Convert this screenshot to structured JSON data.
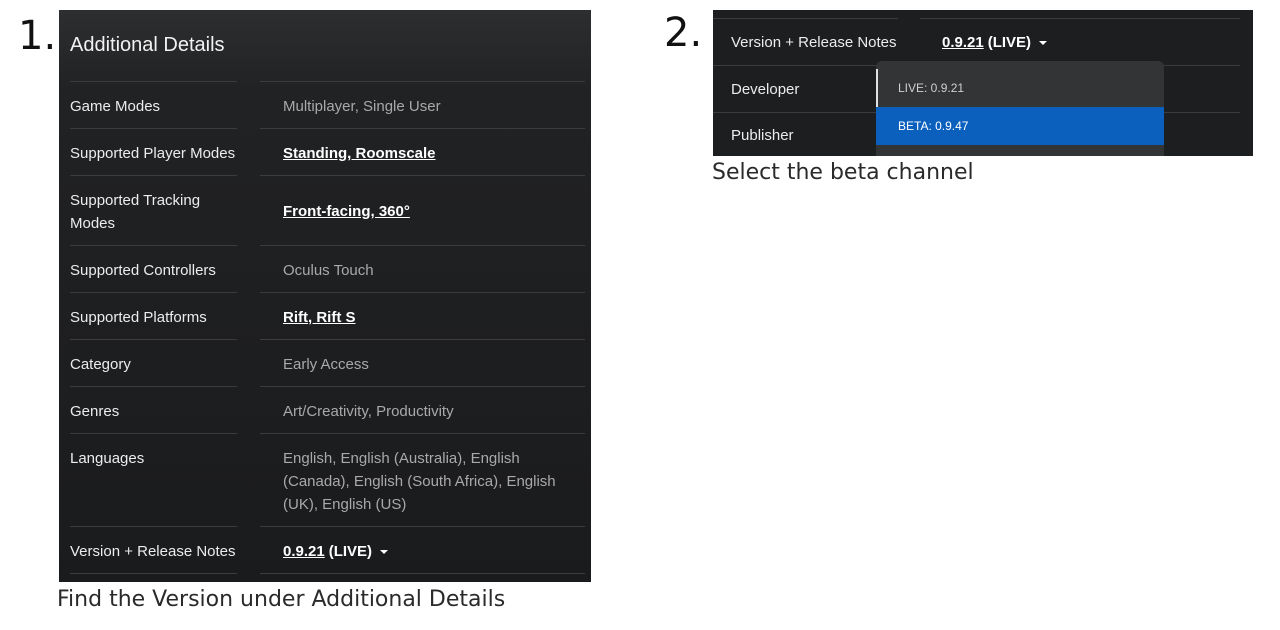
{
  "steps": [
    {
      "number": "1.",
      "caption": "Find the Version under Additional Details",
      "panel": {
        "title": "Additional Details",
        "rows": [
          {
            "label": "Game Modes",
            "value": "Multiplayer, Single User",
            "link": false
          },
          {
            "label": "Supported Player Modes",
            "value": "Standing, Roomscale",
            "link": true
          },
          {
            "label": "Supported Tracking Modes",
            "value": "Front-facing, 360°",
            "link": true
          },
          {
            "label": "Supported Controllers",
            "value": "Oculus Touch",
            "link": false
          },
          {
            "label": "Supported Platforms",
            "value": "Rift, Rift S",
            "link": true
          },
          {
            "label": "Category",
            "value": "Early Access",
            "link": false
          },
          {
            "label": "Genres",
            "value": "Art/Creativity, Productivity",
            "link": false
          },
          {
            "label": "Languages",
            "value": "English, English (Australia), English (Canada), English (South Africa), English (UK), English (US)",
            "link": false
          }
        ],
        "version": {
          "label": "Version + Release Notes",
          "number": "0.9.21",
          "channel": "(LIVE)"
        }
      }
    },
    {
      "number": "2.",
      "caption": "Select the beta channel",
      "panel": {
        "version": {
          "label": "Version + Release Notes",
          "number": "0.9.21",
          "channel": "(LIVE)"
        },
        "rows": [
          {
            "label": "Developer"
          },
          {
            "label": "Publisher"
          }
        ],
        "dropdown": {
          "options": [
            "LIVE: 0.9.21",
            "BETA: 0.9.47"
          ],
          "selected": "BETA: 0.9.47"
        }
      }
    }
  ],
  "colors": {
    "panel_bg": "#212224",
    "divider": "#3b3c3f",
    "selected_bg": "#0b5fbd"
  },
  "icons": {
    "dropdown": "caret-down-icon"
  }
}
